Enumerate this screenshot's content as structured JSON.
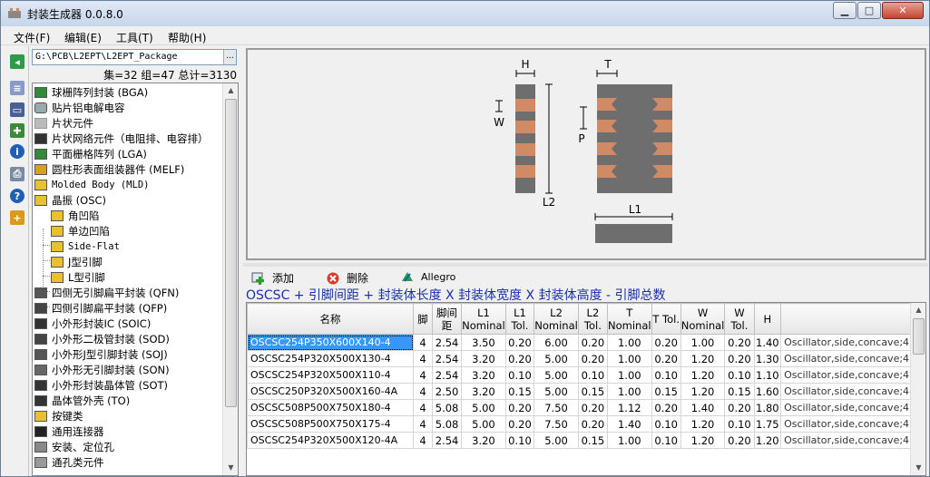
{
  "window": {
    "title": "封装生成器 0.0.8.0",
    "min_glyph": "▁",
    "max_glyph": "□",
    "close_glyph": "✕"
  },
  "menu": {
    "file": "文件(F)",
    "edit": "编辑(E)",
    "tools": "工具(T)",
    "help": "帮助(H)"
  },
  "path": {
    "value": "G:\\PCB\\L2EPT\\L2EPT_Package",
    "browse": "..."
  },
  "stats": "集=32 组=47 总计=3130",
  "tree": {
    "items": [
      {
        "label": "球栅阵列封装 (BGA)",
        "icon": "bga-icon"
      },
      {
        "label": "贴片铝电解电容",
        "icon": "capacitor-icon"
      },
      {
        "label": "片状元件",
        "icon": "chip-icon"
      },
      {
        "label": "片状网络元件（电阻排、电容排）",
        "icon": "network-icon"
      },
      {
        "label": "平面栅格阵列 (LGA)",
        "icon": "lga-icon"
      },
      {
        "label": "圆柱形表面组装器件 (MELF)",
        "icon": "melf-icon"
      },
      {
        "label": "Molded Body (MLD)",
        "icon": "mld-icon"
      },
      {
        "label": "晶振 (OSC)",
        "icon": "osc-icon"
      },
      {
        "label": "角凹陷",
        "icon": "osc-icon"
      },
      {
        "label": "单边凹陷",
        "icon": "osc-icon"
      },
      {
        "label": "Side-Flat",
        "icon": "osc-icon"
      },
      {
        "label": "J型引脚",
        "icon": "osc-icon"
      },
      {
        "label": "L型引脚",
        "icon": "osc-icon"
      },
      {
        "label": "四侧无引脚扁平封装 (QFN)",
        "icon": "qfn-icon"
      },
      {
        "label": "四侧引脚扁平封装 (QFP)",
        "icon": "qfp-icon"
      },
      {
        "label": "小外形封装IC (SOIC)",
        "icon": "soic-icon"
      },
      {
        "label": "小外形二极管封装 (SOD)",
        "icon": "sod-icon"
      },
      {
        "label": "小外形J型引脚封装 (SOJ)",
        "icon": "soj-icon"
      },
      {
        "label": "小外形无引脚封装 (SON)",
        "icon": "son-icon"
      },
      {
        "label": "小外形封装晶体管 (SOT)",
        "icon": "sot-icon"
      },
      {
        "label": "晶体管外壳 (TO)",
        "icon": "to-icon"
      },
      {
        "label": "按键类",
        "icon": "button-icon"
      },
      {
        "label": "通用连接器",
        "icon": "connector-icon"
      },
      {
        "label": "安装、定位孔",
        "icon": "hole-icon"
      },
      {
        "label": "通孔类元件",
        "icon": "through-hole-icon"
      }
    ]
  },
  "preview": {
    "h": "H",
    "w": "W",
    "l2": "L2",
    "t": "T",
    "p": "P",
    "l1": "L1"
  },
  "actions": {
    "add": "添加",
    "delete": "删除",
    "allegro": "Allegro"
  },
  "formula": "OSCSC + 引脚间距 + 封装体长度 X 封装体宽度 X 封装体高度 - 引脚总数",
  "table": {
    "headers": [
      "名称",
      "脚",
      "脚间距",
      "L1 Nominal",
      "L1 Tol.",
      "L2 Nominal",
      "L2 Tol.",
      "T Nominal",
      "T Tol.",
      "W Nominal",
      "W Tol.",
      "H",
      ""
    ],
    "rows": [
      [
        "OSCSC254P350X600X140-4",
        "4",
        "2.54",
        "3.50",
        "0.20",
        "6.00",
        "0.20",
        "1.00",
        "0.20",
        "1.00",
        "0.20",
        "1.40",
        "Oscillator,side,concave;4 pi"
      ],
      [
        "OSCSC254P320X500X130-4",
        "4",
        "2.54",
        "3.20",
        "0.20",
        "5.00",
        "0.20",
        "1.00",
        "0.20",
        "1.20",
        "0.20",
        "1.30",
        "Oscillator,side,concave;4 pi"
      ],
      [
        "OSCSC254P320X500X110-4",
        "4",
        "2.54",
        "3.20",
        "0.10",
        "5.00",
        "0.10",
        "1.00",
        "0.10",
        "1.20",
        "0.10",
        "1.10",
        "Oscillator,side,concave;4 pi"
      ],
      [
        "OSCSC250P320X500X160-4A",
        "4",
        "2.50",
        "3.20",
        "0.15",
        "5.00",
        "0.15",
        "1.00",
        "0.15",
        "1.20",
        "0.15",
        "1.60",
        "Oscillator,side,concave;4 pi"
      ],
      [
        "OSCSC508P500X750X180-4",
        "4",
        "5.08",
        "5.00",
        "0.20",
        "7.50",
        "0.20",
        "1.12",
        "0.20",
        "1.40",
        "0.20",
        "1.80",
        "Oscillator,side,concave;4 pi"
      ],
      [
        "OSCSC508P500X750X175-4",
        "4",
        "5.08",
        "5.00",
        "0.20",
        "7.50",
        "0.20",
        "1.40",
        "0.10",
        "1.20",
        "0.10",
        "1.75",
        "Oscillator,side,concave;4 pi"
      ],
      [
        "OSCSC254P320X500X120-4A",
        "4",
        "2.54",
        "3.20",
        "0.10",
        "5.00",
        "0.15",
        "1.00",
        "0.10",
        "1.20",
        "0.20",
        "1.20",
        "Oscillator,side,concave;4 Pi"
      ]
    ]
  },
  "colors": {
    "pad": "#d08a66",
    "body": "#6e6e6e",
    "selection": "#3399ff",
    "formula": "#1a2fa8"
  }
}
